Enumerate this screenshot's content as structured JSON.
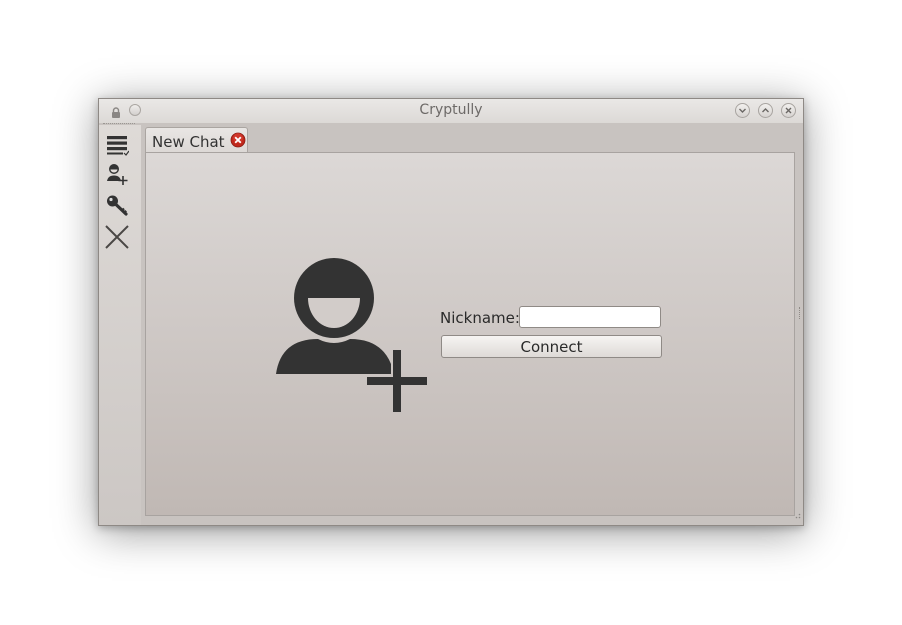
{
  "window": {
    "title": "Cryptully",
    "buttons": [
      "minimize",
      "maximize",
      "close"
    ]
  },
  "sidebar": {
    "items": [
      {
        "icon": "menu-icon",
        "action": "menu"
      },
      {
        "icon": "add-user-icon",
        "action": "new-chat"
      },
      {
        "icon": "key-icon",
        "action": "keys"
      },
      {
        "icon": "close-x-icon",
        "action": "exit"
      }
    ]
  },
  "tabs": [
    {
      "label": "New Chat",
      "closable": true,
      "active": true
    }
  ],
  "new_chat": {
    "nickname_label": "Nickname:",
    "nickname_value": "",
    "connect_label": "Connect"
  },
  "colors": {
    "window_bg": "#c8c3c0",
    "icon_dark": "#333333",
    "tab_close_red": "#c0281c"
  }
}
